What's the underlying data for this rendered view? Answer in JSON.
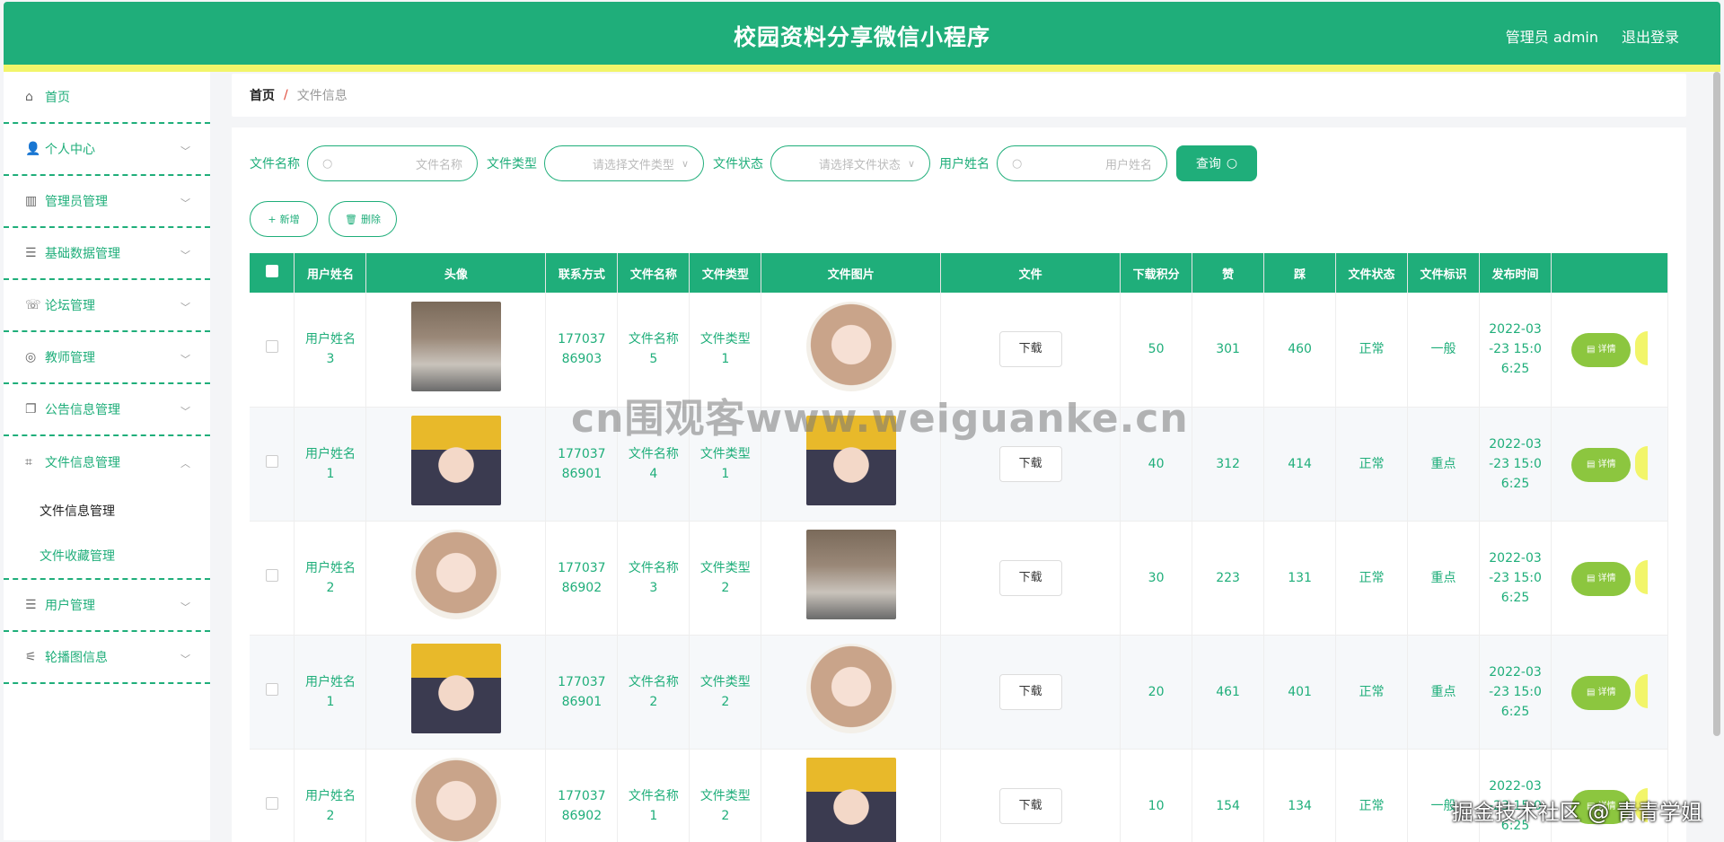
{
  "header": {
    "title": "校园资料分享微信小程序",
    "user": "管理员 admin",
    "logout": "退出登录"
  },
  "sidebar": {
    "items": [
      {
        "label": "首页",
        "icon": "home-icon",
        "glyph": "⌂"
      },
      {
        "label": "个人中心",
        "icon": "user-icon",
        "glyph": "👤"
      },
      {
        "label": "管理员管理",
        "icon": "books-icon",
        "glyph": "▥"
      },
      {
        "label": "基础数据管理",
        "icon": "list-icon",
        "glyph": "☰"
      },
      {
        "label": "论坛管理",
        "icon": "chat-icon",
        "glyph": "☏"
      },
      {
        "label": "教师管理",
        "icon": "settings-icon",
        "glyph": "◎"
      },
      {
        "label": "公告信息管理",
        "icon": "copy-icon",
        "glyph": "❐"
      },
      {
        "label": "文件信息管理",
        "icon": "crop-icon",
        "glyph": "⌗"
      },
      {
        "label": "用户管理",
        "icon": "list-icon",
        "glyph": "☰"
      },
      {
        "label": "轮播图信息",
        "icon": "sliders-icon",
        "glyph": "⚟"
      }
    ],
    "submenu": [
      "文件信息管理",
      "文件收藏管理"
    ]
  },
  "breadcrumb": {
    "home": "首页",
    "sep": "/",
    "current": "文件信息"
  },
  "search": {
    "file_name_label": "文件名称",
    "file_name_placeholder": "文件名称",
    "file_type_label": "文件类型",
    "file_type_placeholder": "请选择文件类型",
    "file_status_label": "文件状态",
    "file_status_placeholder": "请选择文件状态",
    "user_name_label": "用户姓名",
    "user_name_placeholder": "用户姓名",
    "query_button": "查询"
  },
  "actions": {
    "add": "新增",
    "delete": "删除"
  },
  "table": {
    "headers": [
      "用户姓名",
      "头像",
      "联系方式",
      "文件名称",
      "文件类型",
      "文件图片",
      "文件",
      "下载积分",
      "赞",
      "踩",
      "文件状态",
      "文件标识",
      "发布时间"
    ],
    "download_label": "下载",
    "detail_label": "详情",
    "rows": [
      {
        "user": "用户姓名3",
        "avatar": "boy",
        "phone": "17703786903",
        "file_name": "文件名称5",
        "file_type": "文件类型1",
        "image": "girl",
        "points": "50",
        "likes": "301",
        "dislikes": "460",
        "status": "正常",
        "tag": "一般",
        "time": "2022-03-23 15:06:25"
      },
      {
        "user": "用户姓名1",
        "avatar": "cartoon",
        "phone": "17703786901",
        "file_name": "文件名称4",
        "file_type": "文件类型1",
        "image": "cartoon",
        "points": "40",
        "likes": "312",
        "dislikes": "414",
        "status": "正常",
        "tag": "重点",
        "time": "2022-03-23 15:06:25"
      },
      {
        "user": "用户姓名2",
        "avatar": "girl",
        "phone": "17703786902",
        "file_name": "文件名称3",
        "file_type": "文件类型2",
        "image": "boy",
        "points": "30",
        "likes": "223",
        "dislikes": "131",
        "status": "正常",
        "tag": "重点",
        "time": "2022-03-23 15:06:25"
      },
      {
        "user": "用户姓名1",
        "avatar": "cartoon",
        "phone": "17703786901",
        "file_name": "文件名称2",
        "file_type": "文件类型2",
        "image": "girl",
        "points": "20",
        "likes": "461",
        "dislikes": "401",
        "status": "正常",
        "tag": "重点",
        "time": "2022-03-23 15:06:25"
      },
      {
        "user": "用户姓名2",
        "avatar": "girl",
        "phone": "17703786902",
        "file_name": "文件名称1",
        "file_type": "文件类型2",
        "image": "cartoon",
        "points": "10",
        "likes": "154",
        "dislikes": "134",
        "status": "正常",
        "tag": "一般",
        "time": "2022-03-23 15:06:25"
      }
    ]
  },
  "watermark": "cn围观客www.weiguanke.cn",
  "credit": "掘金技术社区 @ 青青学姐",
  "colors": {
    "primary": "#1fae7a",
    "accent_yellow": "#f2f56a",
    "detail_green": "#8cc63f"
  }
}
